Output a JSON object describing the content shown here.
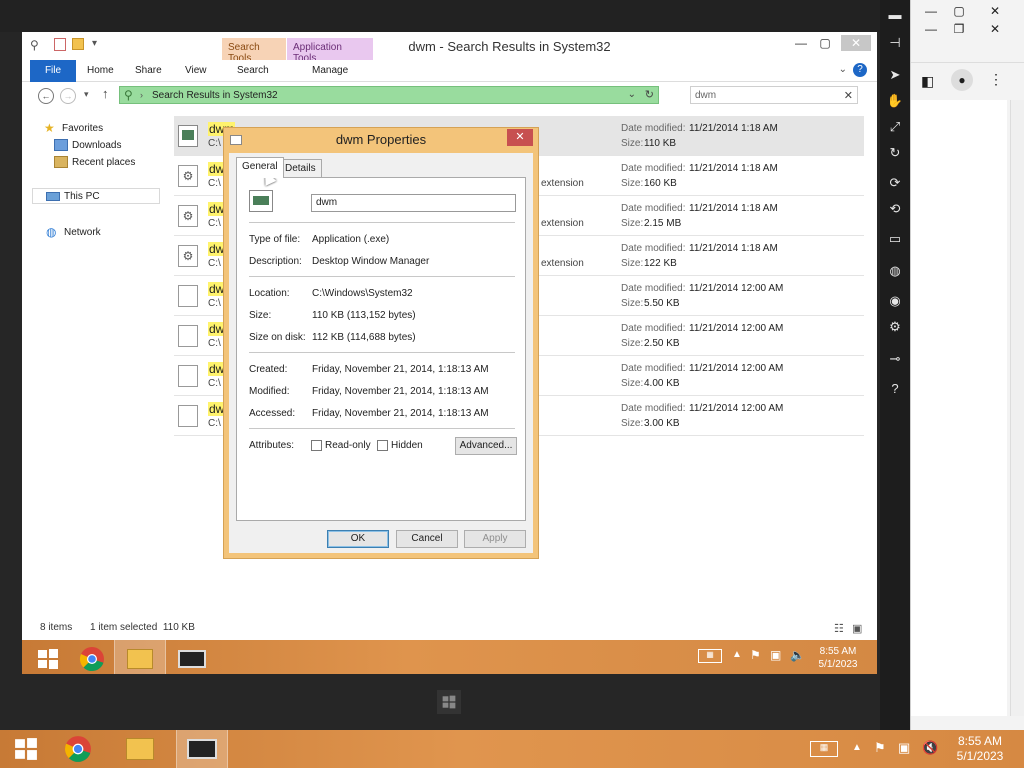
{
  "explorer": {
    "title": "dwm - Search Results in System32",
    "context_tabs": [
      "Search Tools",
      "Application Tools"
    ],
    "ribbon_tabs": [
      "File",
      "Home",
      "Share",
      "View",
      "Search",
      "Manage"
    ],
    "address": "Search Results in System32",
    "search_value": "dwm",
    "nav": {
      "favorites": "Favorites",
      "downloads": "Downloads",
      "recent": "Recent places",
      "thispc": "This PC",
      "network": "Network"
    },
    "files": [
      {
        "name": "dwm",
        "path": "C:\\",
        "type": "",
        "date_label": "Date modified:",
        "date": "11/21/2014 1:18 AM",
        "size_label": "Size:",
        "size": "110 KB",
        "kind": "app"
      },
      {
        "name": "dwm",
        "path": "C:\\",
        "type": "extension",
        "date_label": "Date modified:",
        "date": "11/21/2014 1:18 AM",
        "size_label": "Size:",
        "size": "160 KB",
        "kind": "gear"
      },
      {
        "name": "dwm",
        "path": "C:\\",
        "type": "extension",
        "date_label": "Date modified:",
        "date": "11/21/2014 1:18 AM",
        "size_label": "Size:",
        "size": "2.15 MB",
        "kind": "gear"
      },
      {
        "name": "dwm",
        "path": "C:\\",
        "type": "extension",
        "date_label": "Date modified:",
        "date": "11/21/2014 1:18 AM",
        "size_label": "Size:",
        "size": "122 KB",
        "kind": "gear"
      },
      {
        "name": "dwm",
        "path": "C:\\",
        "type": "",
        "date_label": "Date modified:",
        "date": "11/21/2014 12:00 AM",
        "size_label": "Size:",
        "size": "5.50 KB",
        "kind": "doc"
      },
      {
        "name": "dwm",
        "path": "C:\\",
        "type": "",
        "date_label": "Date modified:",
        "date": "11/21/2014 12:00 AM",
        "size_label": "Size:",
        "size": "2.50 KB",
        "kind": "doc"
      },
      {
        "name": "dwm",
        "path": "C:\\",
        "type": "",
        "date_label": "Date modified:",
        "date": "11/21/2014 12:00 AM",
        "size_label": "Size:",
        "size": "4.00 KB",
        "kind": "doc"
      },
      {
        "name": "dwm",
        "path": "C:\\",
        "type": "",
        "date_label": "Date modified:",
        "date": "11/21/2014 12:00 AM",
        "size_label": "Size:",
        "size": "3.00 KB",
        "kind": "doc"
      }
    ],
    "status_items": "8 items",
    "status_selected": "1 item selected  110 KB"
  },
  "dialog": {
    "title": "dwm Properties",
    "tabs": [
      "General",
      "Details"
    ],
    "name_value": "dwm",
    "type_label": "Type of file:",
    "type_value": "Application (.exe)",
    "desc_label": "Description:",
    "desc_value": "Desktop Window Manager",
    "location_label": "Location:",
    "location_value": "C:\\Windows\\System32",
    "size_label": "Size:",
    "size_value": "110 KB (113,152 bytes)",
    "disk_label": "Size on disk:",
    "disk_value": "112 KB (114,688 bytes)",
    "created_label": "Created:",
    "created_value": "Friday, November 21, 2014, 1:18:13 AM",
    "modified_label": "Modified:",
    "modified_value": "Friday, November 21, 2014, 1:18:13 AM",
    "accessed_label": "Accessed:",
    "accessed_value": "Friday, November 21, 2014, 1:18:13 AM",
    "attributes_label": "Attributes:",
    "readonly_label": "Read-only",
    "hidden_label": "Hidden",
    "advanced_label": "Advanced...",
    "ok_label": "OK",
    "cancel_label": "Cancel",
    "apply_label": "Apply"
  },
  "vm_taskbar": {
    "time": "8:55 AM",
    "date": "5/1/2023"
  },
  "host_taskbar": {
    "time": "8:55 AM",
    "date": "5/1/2023"
  },
  "colors": {
    "accent_blue": "#1d67c6",
    "taskbar_orange": "#d68943",
    "address_green": "#99dc9e",
    "dialog_frame": "#f3c47a",
    "close_red": "#c75050"
  }
}
